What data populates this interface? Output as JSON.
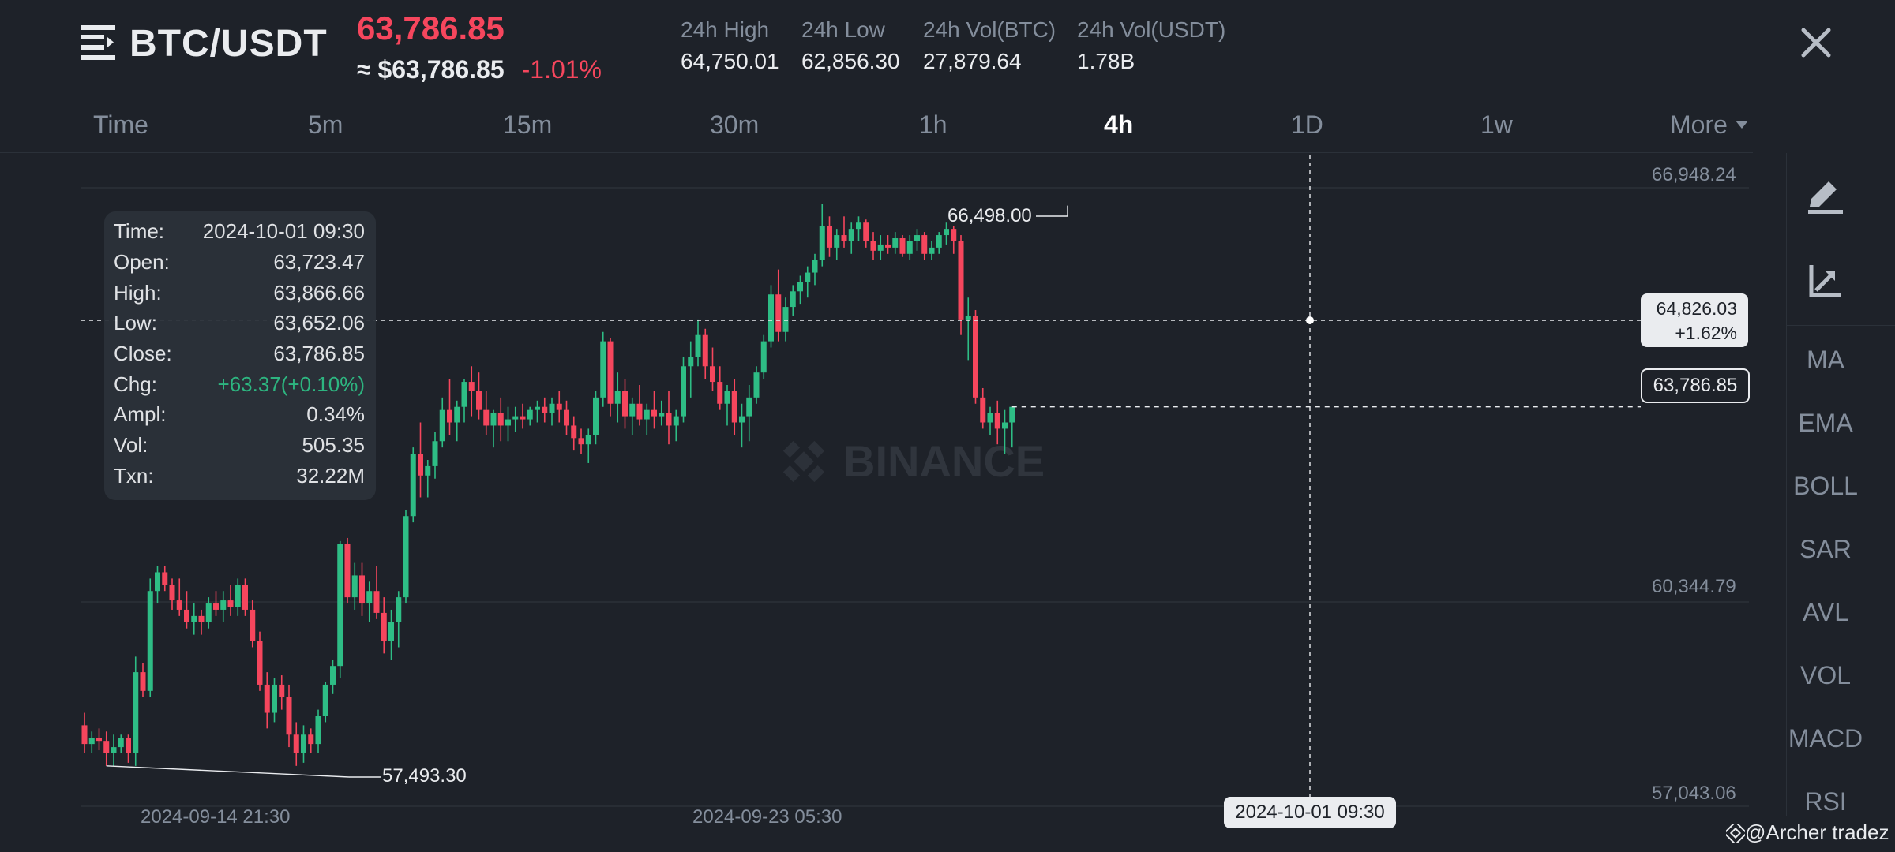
{
  "header": {
    "pair": "BTC/USDT",
    "last_price": "63,786.85",
    "fiat_price": "≈ $63,786.85",
    "change_pct": "-1.01%",
    "stats": [
      {
        "label": "24h High",
        "value": "64,750.01"
      },
      {
        "label": "24h Low",
        "value": "62,856.30"
      },
      {
        "label": "24h Vol(BTC)",
        "value": "27,879.64"
      },
      {
        "label": "24h Vol(USDT)",
        "value": "1.78B"
      }
    ]
  },
  "timeframes": [
    "Time",
    "5m",
    "15m",
    "30m",
    "1h",
    "4h",
    "1D",
    "1w",
    "More"
  ],
  "active_timeframe": "4h",
  "tooltip": {
    "rows": [
      {
        "key": "Time:",
        "value": "2024-10-01 09:30"
      },
      {
        "key": "Open:",
        "value": "63,723.47"
      },
      {
        "key": "High:",
        "value": "63,866.66"
      },
      {
        "key": "Low:",
        "value": "63,652.06"
      },
      {
        "key": "Close:",
        "value": "63,786.85"
      },
      {
        "key": "Chg:",
        "value": "+63.37(+0.10%)"
      },
      {
        "key": "Ampl:",
        "value": "0.34%"
      },
      {
        "key": "Vol:",
        "value": "505.35"
      },
      {
        "key": "Txn:",
        "value": "32.22M"
      }
    ]
  },
  "indicators": [
    "MA",
    "EMA",
    "BOLL",
    "SAR",
    "AVL",
    "VOL",
    "MACD",
    "RSI"
  ],
  "crosshair": {
    "price": "64,826.03",
    "pct": "+1.62%",
    "date": "2024-10-01 09:30"
  },
  "current_price_label": "63,786.85",
  "watermark_center": "BINANCE",
  "watermark_credit": "@Archer tradez",
  "colors": {
    "up": "#2ebd85",
    "down": "#f6465d",
    "background": "#1e2229"
  },
  "icons": [
    "menu-icon",
    "close-icon",
    "caret-down-icon",
    "pencil-icon",
    "chart-trend-icon",
    "binance-logo-icon"
  ],
  "chart_data": {
    "type": "candlestick",
    "symbol": "BTC/USDT",
    "interval": "4h",
    "y_axis_labels": [
      "66,948.24",
      "60,344.79",
      "57,043.06"
    ],
    "ylim": [
      57043.06,
      66948.24
    ],
    "x_axis_labels": [
      "2024-09-14 21:30",
      "2024-09-23 05:30"
    ],
    "annotations": {
      "max": "66,498.00",
      "min": "57,493.30"
    },
    "max_value": 66498.0,
    "min_value": 57493.3,
    "ohlc": [
      [
        58150,
        58350,
        57700,
        57850
      ],
      [
        57850,
        58050,
        57700,
        57950
      ],
      [
        57950,
        58100,
        57750,
        57900
      ],
      [
        57900,
        58050,
        57500,
        57700
      ],
      [
        57700,
        58000,
        57500,
        57800
      ],
      [
        57800,
        58000,
        57700,
        57950
      ],
      [
        57950,
        58000,
        57550,
        57700
      ],
      [
        57700,
        59250,
        57500,
        59000
      ],
      [
        59000,
        59150,
        58600,
        58700
      ],
      [
        58700,
        60500,
        58600,
        60300
      ],
      [
        60300,
        60700,
        60100,
        60600
      ],
      [
        60600,
        60700,
        60300,
        60400
      ],
      [
        60400,
        60500,
        60000,
        60150
      ],
      [
        60150,
        60500,
        59900,
        60000
      ],
      [
        60000,
        60300,
        59700,
        59800
      ],
      [
        59800,
        60100,
        59600,
        59900
      ],
      [
        59900,
        60000,
        59600,
        59800
      ],
      [
        59800,
        60200,
        59700,
        60100
      ],
      [
        60100,
        60300,
        59900,
        60000
      ],
      [
        60000,
        60300,
        59800,
        60150
      ],
      [
        60150,
        60400,
        59900,
        60050
      ],
      [
        60050,
        60500,
        59900,
        60400
      ],
      [
        60400,
        60500,
        59900,
        60000
      ],
      [
        60000,
        60150,
        59400,
        59500
      ],
      [
        59500,
        59650,
        58700,
        58800
      ],
      [
        58800,
        59000,
        58100,
        58350
      ],
      [
        58350,
        58900,
        58200,
        58800
      ],
      [
        58800,
        58950,
        58400,
        58600
      ],
      [
        58600,
        58800,
        57800,
        58000
      ],
      [
        58000,
        58200,
        57500,
        57700
      ],
      [
        57700,
        58150,
        57550,
        58000
      ],
      [
        58000,
        58100,
        57700,
        57850
      ],
      [
        57850,
        58400,
        57700,
        58300
      ],
      [
        58300,
        58850,
        58200,
        58800
      ],
      [
        58800,
        59200,
        58650,
        59100
      ],
      [
        59100,
        61100,
        58900,
        61050
      ],
      [
        61050,
        61150,
        60100,
        60200
      ],
      [
        60200,
        60750,
        60000,
        60550
      ],
      [
        60550,
        60750,
        59900,
        60100
      ],
      [
        60100,
        60450,
        59800,
        60300
      ],
      [
        60300,
        60700,
        59850,
        59950
      ],
      [
        59950,
        60200,
        59300,
        59500
      ],
      [
        59500,
        60000,
        59200,
        59800
      ],
      [
        59800,
        60300,
        59400,
        60200
      ],
      [
        60200,
        61600,
        60100,
        61500
      ],
      [
        61500,
        62600,
        61400,
        62500
      ],
      [
        62500,
        63000,
        61800,
        62150
      ],
      [
        62150,
        62400,
        61800,
        62300
      ],
      [
        62300,
        62850,
        62100,
        62700
      ],
      [
        62700,
        63400,
        62600,
        63200
      ],
      [
        63200,
        63700,
        62800,
        63000
      ],
      [
        63000,
        63350,
        62700,
        63250
      ],
      [
        63250,
        63700,
        63000,
        63650
      ],
      [
        63650,
        63900,
        63100,
        63500
      ],
      [
        63500,
        63800,
        63050,
        63200
      ],
      [
        63200,
        63500,
        62800,
        62950
      ],
      [
        62950,
        63200,
        62600,
        63150
      ],
      [
        63150,
        63400,
        62700,
        62950
      ],
      [
        62950,
        63250,
        62700,
        63050
      ],
      [
        63050,
        63250,
        62850,
        63100
      ],
      [
        63100,
        63300,
        62900,
        63050
      ],
      [
        63050,
        63250,
        62950,
        63200
      ],
      [
        63200,
        63350,
        63000,
        63250
      ],
      [
        63250,
        63400,
        63000,
        63150
      ],
      [
        63150,
        63400,
        62950,
        63300
      ],
      [
        63300,
        63500,
        63000,
        63200
      ],
      [
        63200,
        63350,
        62800,
        62950
      ],
      [
        62950,
        63100,
        62550,
        62750
      ],
      [
        62750,
        62900,
        62500,
        62650
      ],
      [
        62650,
        62900,
        62350,
        62800
      ],
      [
        62800,
        63500,
        62650,
        63400
      ],
      [
        63400,
        64450,
        63250,
        64300
      ],
      [
        64300,
        64350,
        63100,
        63300
      ],
      [
        63300,
        63800,
        63000,
        63500
      ],
      [
        63500,
        63700,
        62900,
        63100
      ],
      [
        63100,
        63400,
        62800,
        63300
      ],
      [
        63300,
        63600,
        62950,
        63050
      ],
      [
        63050,
        63300,
        62800,
        63200
      ],
      [
        63200,
        63500,
        62900,
        63100
      ],
      [
        63100,
        63350,
        62950,
        63150
      ],
      [
        63150,
        63500,
        62650,
        62950
      ],
      [
        62950,
        63200,
        62700,
        63100
      ],
      [
        63100,
        64050,
        63000,
        63900
      ],
      [
        63900,
        64300,
        63400,
        64050
      ],
      [
        64050,
        64650,
        63900,
        64400
      ],
      [
        64400,
        64500,
        63700,
        63900
      ],
      [
        63900,
        64200,
        63500,
        63650
      ],
      [
        63650,
        63900,
        63200,
        63300
      ],
      [
        63300,
        63600,
        62950,
        63500
      ],
      [
        63500,
        63700,
        62800,
        63000
      ],
      [
        63000,
        63300,
        62600,
        63100
      ],
      [
        63100,
        63600,
        62700,
        63400
      ],
      [
        63400,
        63900,
        63300,
        63800
      ],
      [
        63800,
        64400,
        63700,
        64300
      ],
      [
        64300,
        65200,
        64200,
        65050
      ],
      [
        65050,
        65450,
        64300,
        64450
      ],
      [
        64450,
        65000,
        64300,
        64850
      ],
      [
        64850,
        65200,
        64700,
        65100
      ],
      [
        65100,
        65350,
        64900,
        65250
      ],
      [
        65250,
        65500,
        65000,
        65400
      ],
      [
        65400,
        65700,
        65200,
        65600
      ],
      [
        65600,
        66498,
        65500,
        66150
      ],
      [
        66150,
        66300,
        65650,
        65800
      ],
      [
        65800,
        66100,
        65600,
        66000
      ],
      [
        66000,
        66300,
        65800,
        65900
      ],
      [
        65900,
        66200,
        65700,
        66100
      ],
      [
        66100,
        66300,
        65900,
        66200
      ],
      [
        66200,
        66250,
        65800,
        65900
      ],
      [
        65900,
        66050,
        65600,
        65750
      ],
      [
        65750,
        66000,
        65600,
        65850
      ],
      [
        65850,
        66000,
        65700,
        65800
      ],
      [
        65800,
        66050,
        65700,
        65950
      ],
      [
        65950,
        66000,
        65650,
        65700
      ],
      [
        65700,
        66000,
        65600,
        65900
      ],
      [
        65900,
        66100,
        65750,
        66000
      ],
      [
        66000,
        66050,
        65600,
        65700
      ],
      [
        65700,
        65900,
        65600,
        65800
      ],
      [
        65800,
        66050,
        65700,
        66000
      ],
      [
        66000,
        66200,
        65850,
        66100
      ],
      [
        66100,
        66150,
        65700,
        65900
      ],
      [
        65900,
        66000,
        64400,
        64650
      ],
      [
        64650,
        65000,
        64000,
        64700
      ],
      [
        64700,
        64800,
        63300,
        63400
      ],
      [
        63400,
        63550,
        62900,
        63000
      ],
      [
        63000,
        63250,
        62800,
        63150
      ],
      [
        63150,
        63350,
        62650,
        62900
      ],
      [
        62900,
        63200,
        62500,
        63000
      ],
      [
        63000,
        63200,
        62600,
        63250
      ]
    ]
  }
}
